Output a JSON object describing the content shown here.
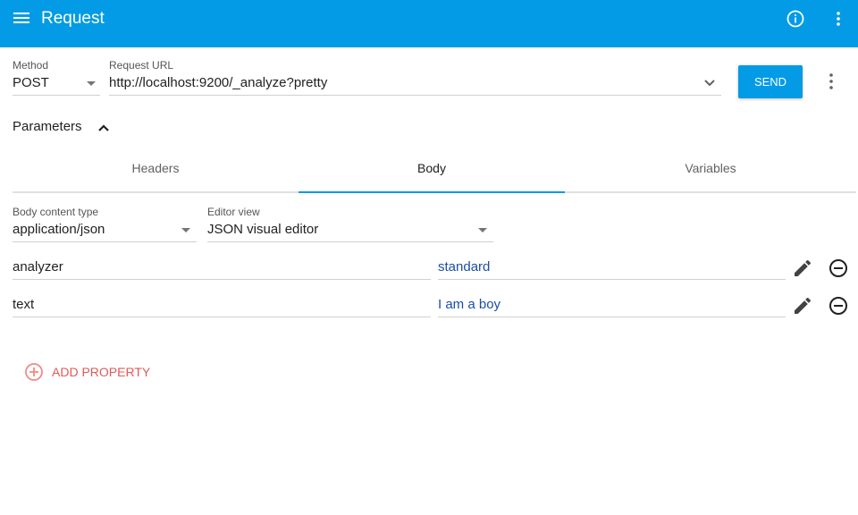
{
  "appbar": {
    "title": "Request",
    "menu_icon": "menu-icon",
    "info_icon": "info-icon",
    "more_icon": "more-vert-icon",
    "color": "#039be5"
  },
  "request": {
    "method_label": "Method",
    "method_value": "POST",
    "url_label": "Request URL",
    "url_value": "http://localhost:9200/_analyze?pretty",
    "send_label": "SEND"
  },
  "parameters": {
    "label": "Parameters",
    "expanded": true,
    "tabs": [
      {
        "label": "Headers",
        "active": false
      },
      {
        "label": "Body",
        "active": true
      },
      {
        "label": "Variables",
        "active": false
      }
    ]
  },
  "body": {
    "content_type_label": "Body content type",
    "content_type_value": "application/json",
    "editor_view_label": "Editor view",
    "editor_view_value": "JSON visual editor",
    "properties": [
      {
        "name": "analyzer",
        "value": "standard"
      },
      {
        "name": "text",
        "value": "I am a boy"
      }
    ],
    "add_property_label": "ADD PROPERTY"
  },
  "colors": {
    "accent": "#039be5",
    "value_text": "#1a4ea6",
    "add_property": "#e05a56"
  }
}
